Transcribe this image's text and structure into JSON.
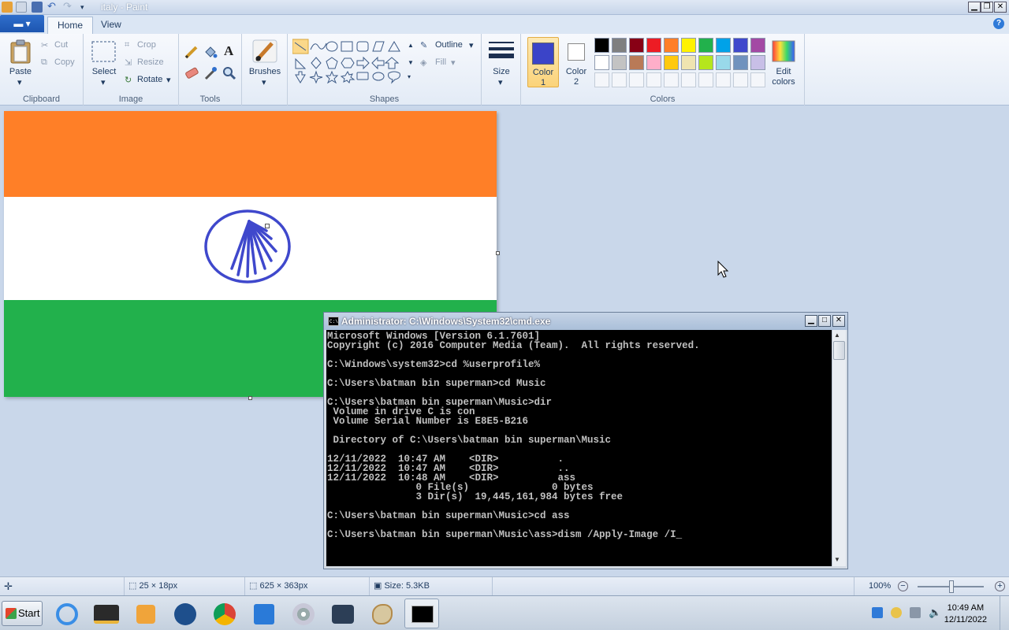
{
  "window": {
    "title": "italy - Paint"
  },
  "ribbon": {
    "file_tab": "▬ ▾",
    "tabs": [
      {
        "label": "Home"
      },
      {
        "label": "View"
      }
    ],
    "clipboard": {
      "paste": "Paste",
      "cut": "Cut",
      "copy": "Copy",
      "label": "Clipboard"
    },
    "image": {
      "select": "Select",
      "crop": "Crop",
      "resize": "Resize",
      "rotate": "Rotate",
      "label": "Image"
    },
    "tools": {
      "label": "Tools"
    },
    "brushes": {
      "label": "Brushes"
    },
    "shapes": {
      "outline": "Outline",
      "fill": "Fill",
      "label": "Shapes"
    },
    "size": {
      "label": "Size"
    },
    "color1": {
      "label": "Color\n1",
      "line1": "Color",
      "line2": "1",
      "value": "#3b44c8"
    },
    "color2": {
      "line1": "Color",
      "line2": "2",
      "value": "#ffffff"
    },
    "colors": {
      "label": "Colors",
      "edit_line1": "Edit",
      "edit_line2": "colors",
      "palette_row1": [
        "#000000",
        "#7f7f7f",
        "#880015",
        "#ed1c24",
        "#ff7f27",
        "#fff200",
        "#22b14c",
        "#00a2e8",
        "#3f48cc",
        "#a349a4"
      ],
      "palette_row2": [
        "#ffffff",
        "#c3c3c3",
        "#b97a57",
        "#ffaec9",
        "#ffc90e",
        "#efe4b0",
        "#b5e61d",
        "#99d9ea",
        "#7092be",
        "#c8bfe7"
      ]
    }
  },
  "canvas": {
    "stripe_colors": [
      "#ff7f27",
      "#ffffff",
      "#22b14c"
    ],
    "wheel_color": "#3f48cc"
  },
  "cmd": {
    "title": "Administrator: C:\\Windows\\System32\\cmd.exe",
    "lines": [
      "Microsoft Windows [Version 6.1.7601]",
      "Copyright (c) 2016 Computer Media (Team).  All rights reserved.",
      "",
      "C:\\Windows\\system32>cd %userprofile%",
      "",
      "C:\\Users\\batman bin superman>cd Music",
      "",
      "C:\\Users\\batman bin superman\\Music>dir",
      " Volume in drive C is con",
      " Volume Serial Number is E8E5-B216",
      "",
      " Directory of C:\\Users\\batman bin superman\\Music",
      "",
      "12/11/2022  10:47 AM    <DIR>          .",
      "12/11/2022  10:47 AM    <DIR>          ..",
      "12/11/2022  10:48 AM    <DIR>          ass",
      "               0 File(s)              0 bytes",
      "               3 Dir(s)  19,445,161,984 bytes free",
      "",
      "C:\\Users\\batman bin superman\\Music>cd ass",
      "",
      "C:\\Users\\batman bin superman\\Music\\ass>dism /Apply-Image /I_"
    ]
  },
  "status": {
    "selection_size": "25 × 18px",
    "image_size": "625 × 363px",
    "file_size": "Size: 5.3KB",
    "zoom": "100%"
  },
  "taskbar": {
    "start": "Start",
    "time": "10:49 AM",
    "date": "12/11/2022"
  }
}
